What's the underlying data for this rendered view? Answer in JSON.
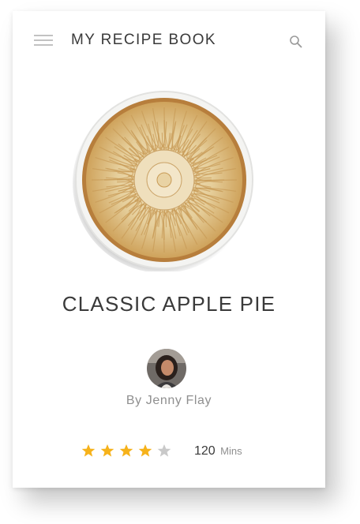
{
  "header": {
    "title": "MY RECIPE BOOK",
    "menu_icon": "hamburger-menu-icon",
    "search_icon": "search-icon"
  },
  "recipe": {
    "image_icon": "apple-pie-photo",
    "title": "CLASSIC APPLE PIE",
    "author_avatar": "author-avatar-photo",
    "author": "By Jenny Flay",
    "rating": 4,
    "rating_max": 5,
    "time_value": "120",
    "time_unit": "Mins"
  },
  "colors": {
    "star_filled": "#f6b21a",
    "star_empty": "#c9c9c9",
    "title_text": "#3a3a3a",
    "muted_text": "#8f8f8f"
  }
}
